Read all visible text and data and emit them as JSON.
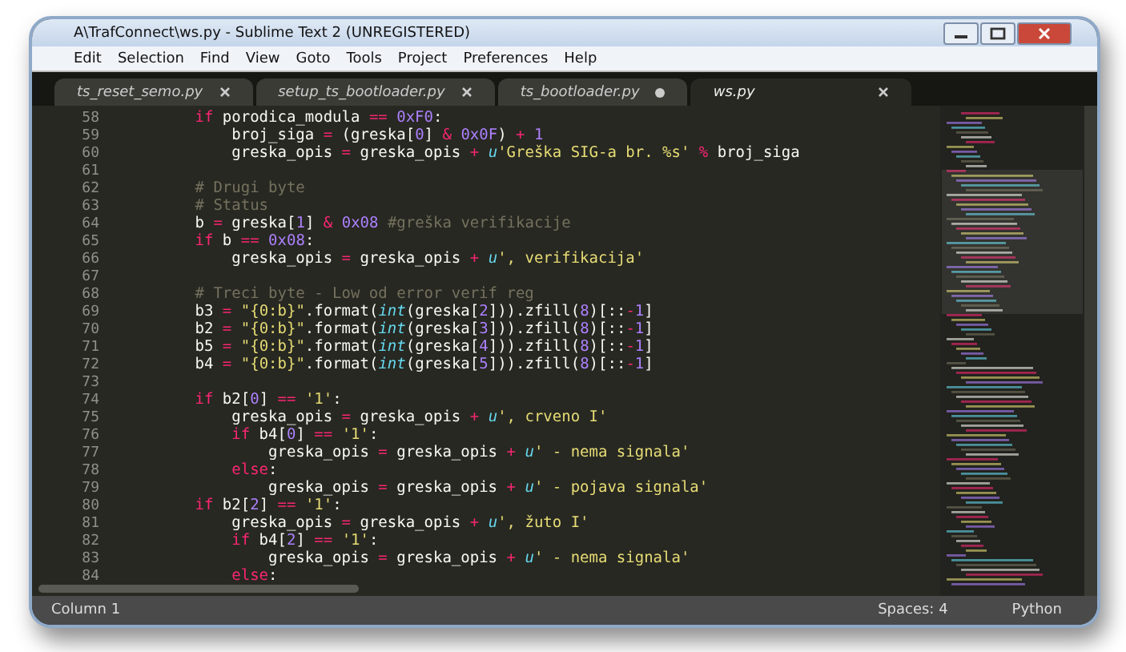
{
  "window": {
    "title": "A\\TrafConnect\\ws.py - Sublime Text 2 (UNREGISTERED)"
  },
  "menu": [
    "Edit",
    "Selection",
    "Find",
    "View",
    "Goto",
    "Tools",
    "Project",
    "Preferences",
    "Help"
  ],
  "tabs": [
    {
      "label": "ts_reset_semo.py",
      "selected": false,
      "modified": false
    },
    {
      "label": "setup_ts_bootloader.py",
      "selected": false,
      "modified": false
    },
    {
      "label": "ts_bootloader.py",
      "selected": false,
      "modified": true
    },
    {
      "label": "ws.py",
      "selected": true,
      "modified": false
    }
  ],
  "code": {
    "lines": [
      {
        "number": "58",
        "tokens": [
          {
            "kind": "keyword",
            "text": "        if"
          },
          {
            "kind": "plain",
            "text": " porodica_modula "
          },
          {
            "kind": "operator",
            "text": "=="
          },
          {
            "kind": "number",
            "text": " 0xF0"
          },
          {
            "kind": "plain",
            "text": ":"
          }
        ]
      },
      {
        "number": "59",
        "tokens": [
          {
            "kind": "plain",
            "text": "            broj_siga "
          },
          {
            "kind": "operator",
            "text": "="
          },
          {
            "kind": "plain",
            "text": " (greska["
          },
          {
            "kind": "number",
            "text": "0"
          },
          {
            "kind": "plain",
            "text": "] "
          },
          {
            "kind": "operator",
            "text": "&"
          },
          {
            "kind": "number",
            "text": " 0x0F"
          },
          {
            "kind": "plain",
            "text": ") "
          },
          {
            "kind": "operator",
            "text": "+"
          },
          {
            "kind": "number",
            "text": " 1"
          }
        ]
      },
      {
        "number": "60",
        "tokens": [
          {
            "kind": "plain",
            "text": "            greska_opis "
          },
          {
            "kind": "operator",
            "text": "="
          },
          {
            "kind": "plain",
            "text": " greska_opis "
          },
          {
            "kind": "operator",
            "text": "+"
          },
          {
            "kind": "builtin",
            "text": " u"
          },
          {
            "kind": "string",
            "text": "'Greška SIG-a br. %s'"
          },
          {
            "kind": "operator",
            "text": " %"
          },
          {
            "kind": "plain",
            "text": " broj_siga"
          }
        ]
      },
      {
        "number": "61"
      },
      {
        "number": "62",
        "tokens": [
          {
            "kind": "comment",
            "text": "        # Drugi byte"
          }
        ]
      },
      {
        "number": "63",
        "tokens": [
          {
            "kind": "comment",
            "text": "        # Status"
          }
        ]
      },
      {
        "number": "64",
        "tokens": [
          {
            "kind": "plain",
            "text": "        b "
          },
          {
            "kind": "operator",
            "text": "="
          },
          {
            "kind": "plain",
            "text": " greska["
          },
          {
            "kind": "number",
            "text": "1"
          },
          {
            "kind": "plain",
            "text": "] "
          },
          {
            "kind": "operator",
            "text": "&"
          },
          {
            "kind": "number",
            "text": " 0x08"
          },
          {
            "kind": "comment",
            "text": " #greška verifikacije"
          }
        ]
      },
      {
        "number": "65",
        "tokens": [
          {
            "kind": "keyword",
            "text": "        if"
          },
          {
            "kind": "plain",
            "text": " b "
          },
          {
            "kind": "operator",
            "text": "=="
          },
          {
            "kind": "number",
            "text": " 0x08"
          },
          {
            "kind": "plain",
            "text": ":"
          }
        ]
      },
      {
        "number": "66",
        "tokens": [
          {
            "kind": "plain",
            "text": "            greska_opis "
          },
          {
            "kind": "operator",
            "text": "="
          },
          {
            "kind": "plain",
            "text": " greska_opis "
          },
          {
            "kind": "operator",
            "text": "+"
          },
          {
            "kind": "builtin",
            "text": " u"
          },
          {
            "kind": "string",
            "text": "', verifikacija'"
          }
        ]
      },
      {
        "number": "67"
      },
      {
        "number": "68",
        "tokens": [
          {
            "kind": "comment",
            "text": "        # Treci byte - Low od error verif reg"
          }
        ]
      },
      {
        "number": "69",
        "tokens": [
          {
            "kind": "plain",
            "text": "        b3 "
          },
          {
            "kind": "operator",
            "text": "="
          },
          {
            "kind": "string",
            "text": " \"{0:b}\""
          },
          {
            "kind": "plain",
            "text": ".format("
          },
          {
            "kind": "builtin",
            "text": "int"
          },
          {
            "kind": "plain",
            "text": "(greska["
          },
          {
            "kind": "number",
            "text": "2"
          },
          {
            "kind": "plain",
            "text": "])).zfill("
          },
          {
            "kind": "number",
            "text": "8"
          },
          {
            "kind": "plain",
            "text": ")[::"
          },
          {
            "kind": "operator",
            "text": "-"
          },
          {
            "kind": "number",
            "text": "1"
          },
          {
            "kind": "plain",
            "text": "]"
          }
        ]
      },
      {
        "number": "70",
        "tokens": [
          {
            "kind": "plain",
            "text": "        b2 "
          },
          {
            "kind": "operator",
            "text": "="
          },
          {
            "kind": "string",
            "text": " \"{0:b}\""
          },
          {
            "kind": "plain",
            "text": ".format("
          },
          {
            "kind": "builtin",
            "text": "int"
          },
          {
            "kind": "plain",
            "text": "(greska["
          },
          {
            "kind": "number",
            "text": "3"
          },
          {
            "kind": "plain",
            "text": "])).zfill("
          },
          {
            "kind": "number",
            "text": "8"
          },
          {
            "kind": "plain",
            "text": ")[::"
          },
          {
            "kind": "operator",
            "text": "-"
          },
          {
            "kind": "number",
            "text": "1"
          },
          {
            "kind": "plain",
            "text": "]"
          }
        ]
      },
      {
        "number": "71",
        "tokens": [
          {
            "kind": "plain",
            "text": "        b5 "
          },
          {
            "kind": "operator",
            "text": "="
          },
          {
            "kind": "string",
            "text": " \"{0:b}\""
          },
          {
            "kind": "plain",
            "text": ".format("
          },
          {
            "kind": "builtin",
            "text": "int"
          },
          {
            "kind": "plain",
            "text": "(greska["
          },
          {
            "kind": "number",
            "text": "4"
          },
          {
            "kind": "plain",
            "text": "])).zfill("
          },
          {
            "kind": "number",
            "text": "8"
          },
          {
            "kind": "plain",
            "text": ")[::"
          },
          {
            "kind": "operator",
            "text": "-"
          },
          {
            "kind": "number",
            "text": "1"
          },
          {
            "kind": "plain",
            "text": "]"
          }
        ]
      },
      {
        "number": "72",
        "tokens": [
          {
            "kind": "plain",
            "text": "        b4 "
          },
          {
            "kind": "operator",
            "text": "="
          },
          {
            "kind": "string",
            "text": " \"{0:b}\""
          },
          {
            "kind": "plain",
            "text": ".format("
          },
          {
            "kind": "builtin",
            "text": "int"
          },
          {
            "kind": "plain",
            "text": "(greska["
          },
          {
            "kind": "number",
            "text": "5"
          },
          {
            "kind": "plain",
            "text": "])).zfill("
          },
          {
            "kind": "number",
            "text": "8"
          },
          {
            "kind": "plain",
            "text": ")[::"
          },
          {
            "kind": "operator",
            "text": "-"
          },
          {
            "kind": "number",
            "text": "1"
          },
          {
            "kind": "plain",
            "text": "]"
          }
        ]
      },
      {
        "number": "73"
      },
      {
        "number": "74",
        "tokens": [
          {
            "kind": "keyword",
            "text": "        if"
          },
          {
            "kind": "plain",
            "text": " b2["
          },
          {
            "kind": "number",
            "text": "0"
          },
          {
            "kind": "plain",
            "text": "] "
          },
          {
            "kind": "operator",
            "text": "=="
          },
          {
            "kind": "string",
            "text": " '1'"
          },
          {
            "kind": "plain",
            "text": ":"
          }
        ]
      },
      {
        "number": "75",
        "tokens": [
          {
            "kind": "plain",
            "text": "            greska_opis "
          },
          {
            "kind": "operator",
            "text": "="
          },
          {
            "kind": "plain",
            "text": " greska_opis "
          },
          {
            "kind": "operator",
            "text": "+"
          },
          {
            "kind": "builtin",
            "text": " u"
          },
          {
            "kind": "string",
            "text": "', crveno I'"
          }
        ]
      },
      {
        "number": "76",
        "tokens": [
          {
            "kind": "keyword",
            "text": "            if"
          },
          {
            "kind": "plain",
            "text": " b4["
          },
          {
            "kind": "number",
            "text": "0"
          },
          {
            "kind": "plain",
            "text": "] "
          },
          {
            "kind": "operator",
            "text": "=="
          },
          {
            "kind": "string",
            "text": " '1'"
          },
          {
            "kind": "plain",
            "text": ":"
          }
        ]
      },
      {
        "number": "77",
        "tokens": [
          {
            "kind": "plain",
            "text": "                greska_opis "
          },
          {
            "kind": "operator",
            "text": "="
          },
          {
            "kind": "plain",
            "text": " greska_opis "
          },
          {
            "kind": "operator",
            "text": "+"
          },
          {
            "kind": "builtin",
            "text": " u"
          },
          {
            "kind": "string",
            "text": "' - nema signala'"
          }
        ]
      },
      {
        "number": "78",
        "tokens": [
          {
            "kind": "keyword",
            "text": "            else"
          },
          {
            "kind": "plain",
            "text": ":"
          }
        ]
      },
      {
        "number": "79",
        "tokens": [
          {
            "kind": "plain",
            "text": "                greska_opis "
          },
          {
            "kind": "operator",
            "text": "="
          },
          {
            "kind": "plain",
            "text": " greska_opis "
          },
          {
            "kind": "operator",
            "text": "+"
          },
          {
            "kind": "builtin",
            "text": " u"
          },
          {
            "kind": "string",
            "text": "' - pojava signala'"
          }
        ]
      },
      {
        "number": "80",
        "tokens": [
          {
            "kind": "keyword",
            "text": "        if"
          },
          {
            "kind": "plain",
            "text": " b2["
          },
          {
            "kind": "number",
            "text": "2"
          },
          {
            "kind": "plain",
            "text": "] "
          },
          {
            "kind": "operator",
            "text": "=="
          },
          {
            "kind": "string",
            "text": " '1'"
          },
          {
            "kind": "plain",
            "text": ":"
          }
        ]
      },
      {
        "number": "81",
        "tokens": [
          {
            "kind": "plain",
            "text": "            greska_opis "
          },
          {
            "kind": "operator",
            "text": "="
          },
          {
            "kind": "plain",
            "text": " greska_opis "
          },
          {
            "kind": "operator",
            "text": "+"
          },
          {
            "kind": "builtin",
            "text": " u"
          },
          {
            "kind": "string",
            "text": "', žuto I'"
          }
        ]
      },
      {
        "number": "82",
        "tokens": [
          {
            "kind": "keyword",
            "text": "            if"
          },
          {
            "kind": "plain",
            "text": " b4["
          },
          {
            "kind": "number",
            "text": "2"
          },
          {
            "kind": "plain",
            "text": "] "
          },
          {
            "kind": "operator",
            "text": "=="
          },
          {
            "kind": "string",
            "text": " '1'"
          },
          {
            "kind": "plain",
            "text": ":"
          }
        ]
      },
      {
        "number": "83",
        "tokens": [
          {
            "kind": "plain",
            "text": "                greska_opis "
          },
          {
            "kind": "operator",
            "text": "="
          },
          {
            "kind": "plain",
            "text": " greska_opis "
          },
          {
            "kind": "operator",
            "text": "+"
          },
          {
            "kind": "builtin",
            "text": " u"
          },
          {
            "kind": "string",
            "text": "' - nema signala'"
          }
        ]
      },
      {
        "number": "84",
        "tokens": [
          {
            "kind": "keyword",
            "text": "            else"
          },
          {
            "kind": "plain",
            "text": ":"
          }
        ]
      }
    ]
  },
  "status_bar": {
    "position": "Column 1",
    "indentation": "Spaces: 4",
    "syntax": "Python"
  }
}
